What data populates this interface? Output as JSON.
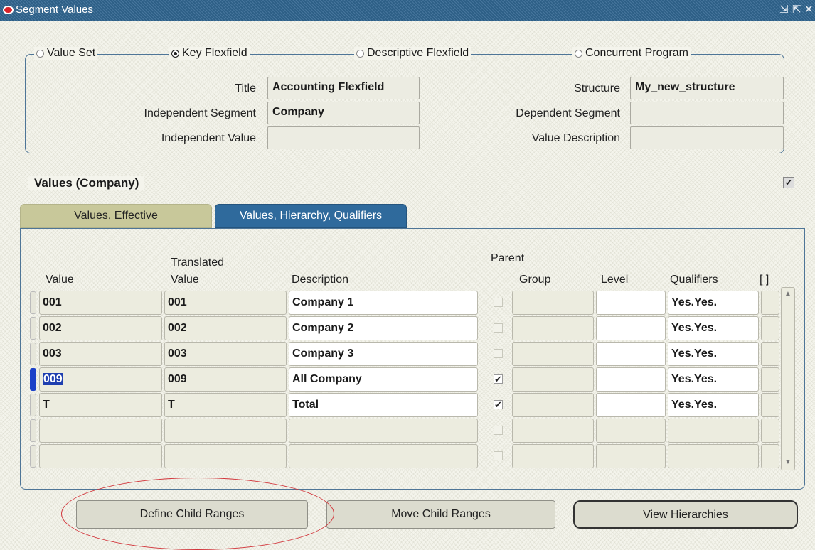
{
  "window": {
    "title": "Segment Values",
    "controls": [
      "minimize-icon",
      "maximize-icon",
      "close-icon"
    ]
  },
  "query_by": {
    "options": [
      {
        "label": "Value Set",
        "selected": false
      },
      {
        "label": "Key Flexfield",
        "selected": true
      },
      {
        "label": "Descriptive Flexfield",
        "selected": false
      },
      {
        "label": "Concurrent Program",
        "selected": false
      }
    ],
    "title_label": "Title",
    "title_value": "Accounting Flexfield",
    "structure_label": "Structure",
    "structure_value": "My_new_structure",
    "independent_segment_label": "Independent Segment",
    "independent_segment_value": "Company",
    "dependent_segment_label": "Dependent Segment",
    "dependent_segment_value": "",
    "independent_value_label": "Independent Value",
    "independent_value_value": "",
    "value_description_label": "Value Description",
    "value_description_value": ""
  },
  "values_section": {
    "title": "Values (Company)",
    "checked": true,
    "tabs": [
      {
        "label": "Values, Effective",
        "active": false
      },
      {
        "label": "Values, Hierarchy, Qualifiers",
        "active": true
      }
    ]
  },
  "grid": {
    "headers": {
      "value": "Value",
      "translated_top": "Translated",
      "translated_bottom": "Value",
      "description": "Description",
      "parent": "Parent",
      "group": "Group",
      "level": "Level",
      "qualifiers": "Qualifiers",
      "extra": "[ ]"
    },
    "rows": [
      {
        "value": "001",
        "translated": "001",
        "description": "Company 1",
        "parent": false,
        "group": "",
        "level": "",
        "qualifiers": "Yes.Yes."
      },
      {
        "value": "002",
        "translated": "002",
        "description": "Company 2",
        "parent": false,
        "group": "",
        "level": "",
        "qualifiers": "Yes.Yes."
      },
      {
        "value": "003",
        "translated": "003",
        "description": "Company 3",
        "parent": false,
        "group": "",
        "level": "",
        "qualifiers": "Yes.Yes."
      },
      {
        "value": "009",
        "translated": "009",
        "description": "All Company",
        "parent": true,
        "group": "",
        "level": "",
        "qualifiers": "Yes.Yes."
      },
      {
        "value": "T",
        "translated": "T",
        "description": "Total",
        "parent": true,
        "group": "",
        "level": "",
        "qualifiers": "Yes.Yes."
      },
      {
        "value": "",
        "translated": "",
        "description": "",
        "parent": false,
        "group": "",
        "level": "",
        "qualifiers": ""
      },
      {
        "value": "",
        "translated": "",
        "description": "",
        "parent": false,
        "group": "",
        "level": "",
        "qualifiers": ""
      }
    ],
    "active_row": 3
  },
  "buttons": {
    "define_child_ranges": "Define Child Ranges",
    "move_child_ranges": "Move Child Ranges",
    "view_hierarchies": "View Hierarchies"
  },
  "annotation_color": "#d2343a"
}
